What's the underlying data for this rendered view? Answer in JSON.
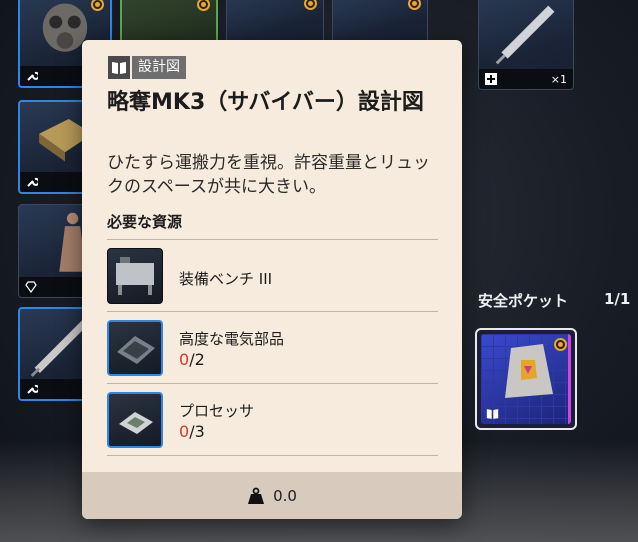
{
  "tooltip": {
    "tag_label": "設計図",
    "title": "略奪MK3（サバイバー）設計図",
    "description": "ひたすら運搬力を重視。許容重量とリュックのスペースが共に大きい。",
    "requirements_heading": "必要な資源",
    "requirements": [
      {
        "name": "装備ベンチ III",
        "count_have": "",
        "count_sep": "",
        "count_need": ""
      },
      {
        "name": "高度な電気部品",
        "count_have": "0",
        "count_sep": "/",
        "count_need": "2"
      },
      {
        "name": "プロセッサ",
        "count_have": "0",
        "count_sep": "/",
        "count_need": "3"
      }
    ],
    "weight": "0.0"
  },
  "side_slot": {
    "count": "×1"
  },
  "safe_pocket": {
    "title": "安全ポケット",
    "count": "1/1"
  },
  "colors": {
    "accent_blue": "#2e86e8",
    "panel_bg": "#f7ebdd",
    "missing_red": "#d43a2a",
    "coin_gold": "#e8a82e"
  }
}
